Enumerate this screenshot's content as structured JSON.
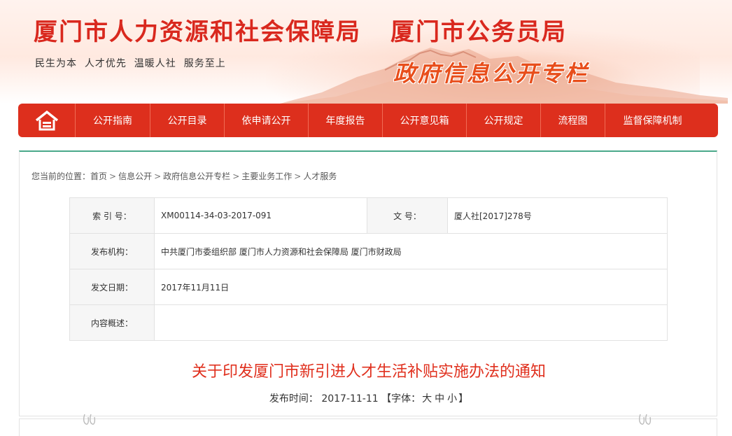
{
  "header": {
    "title_left": "厦门市人力资源和社会保障局",
    "title_right": "厦门市公务员局",
    "slogan": "民生为本  人才优先  温暖人社  服务至上",
    "column_title": "政府信息公开专栏"
  },
  "nav": {
    "home_icon": "home-icon",
    "items": [
      "公开指南",
      "公开目录",
      "依申请公开",
      "年度报告",
      "公开意见箱",
      "公开规定",
      "流程图",
      "监督保障机制"
    ]
  },
  "breadcrumb": {
    "prefix": "您当前的位置：",
    "items": [
      "首页",
      "信息公开",
      "政府信息公开专栏",
      "主要业务工作",
      "人才服务"
    ],
    "separator": ">"
  },
  "meta": {
    "index_label": "索 引 号：",
    "index_value": "XM00114-34-03-2017-091",
    "docno_label": "文    号：",
    "docno_value": "厦人社[2017]278号",
    "org_label": "发布机构：",
    "org_value": "中共厦门市委组织部 厦门市人力资源和社会保障局 厦门市财政局",
    "date_label": "发文日期：",
    "date_value": "2017年11月11日",
    "summary_label": "内容概述：",
    "summary_value": ""
  },
  "article": {
    "title": "关于印发厦门市新引进人才生活补贴实施办法的通知",
    "pub_label": "发布时间：",
    "pub_date": "2017-11-11",
    "font_open": "【字体：",
    "font_large": "大",
    "font_medium": "中",
    "font_small": "小",
    "font_close": "】"
  },
  "colors": {
    "brand_red": "#dd2f1d",
    "title_red": "#d9281e",
    "accent_orange": "#e84e1b",
    "panel_top_border": "#4aa88a"
  }
}
